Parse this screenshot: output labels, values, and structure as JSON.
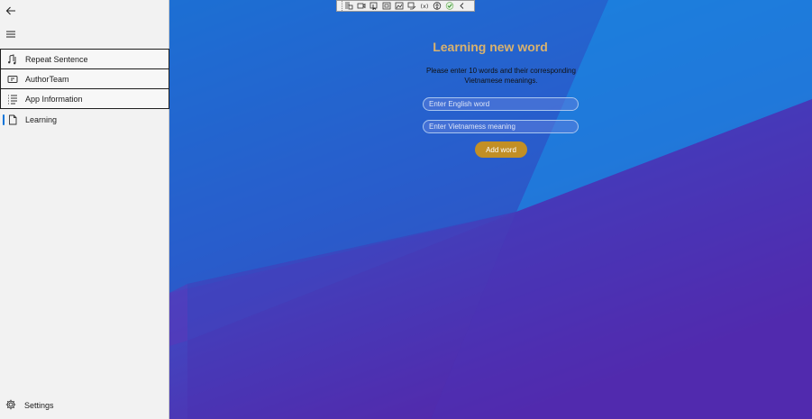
{
  "nav": {
    "items": [
      {
        "label": "Repeat Sentence",
        "icon": "music-note-icon"
      },
      {
        "label": "AuthorTeam",
        "icon": "people-icon"
      },
      {
        "label": "App Information",
        "icon": "list-icon"
      },
      {
        "label": "Learning",
        "icon": "page-icon"
      }
    ],
    "settings_label": "Settings",
    "selected": "Learning"
  },
  "learning": {
    "title": "Learning new word",
    "instruction": "Please enter 10 words and their corresponding Vietnamese meanings.",
    "english_placeholder": "Enter English word",
    "english_value": "",
    "vietnamese_placeholder": "Enter Vietnamess meaning",
    "vietnamese_value": "",
    "add_button_label": "Add word"
  },
  "colors": {
    "title": "#d9b26e",
    "button": "#c28f25",
    "background_top": "#1f80d9",
    "background_bottom": "#5a24a8",
    "nav_background": "#f2f2f2",
    "selection_indicator": "#0a74d9"
  },
  "toolbar": {
    "icons": [
      "live-visual-tree-icon",
      "record-icon",
      "select-element-icon",
      "display-layout-adorners-icon",
      "track-focus-icon",
      "binding-failures-icon",
      "hot-reload-icon",
      "accessibility-icon",
      "checkmark-icon",
      "collapse-icon"
    ]
  }
}
